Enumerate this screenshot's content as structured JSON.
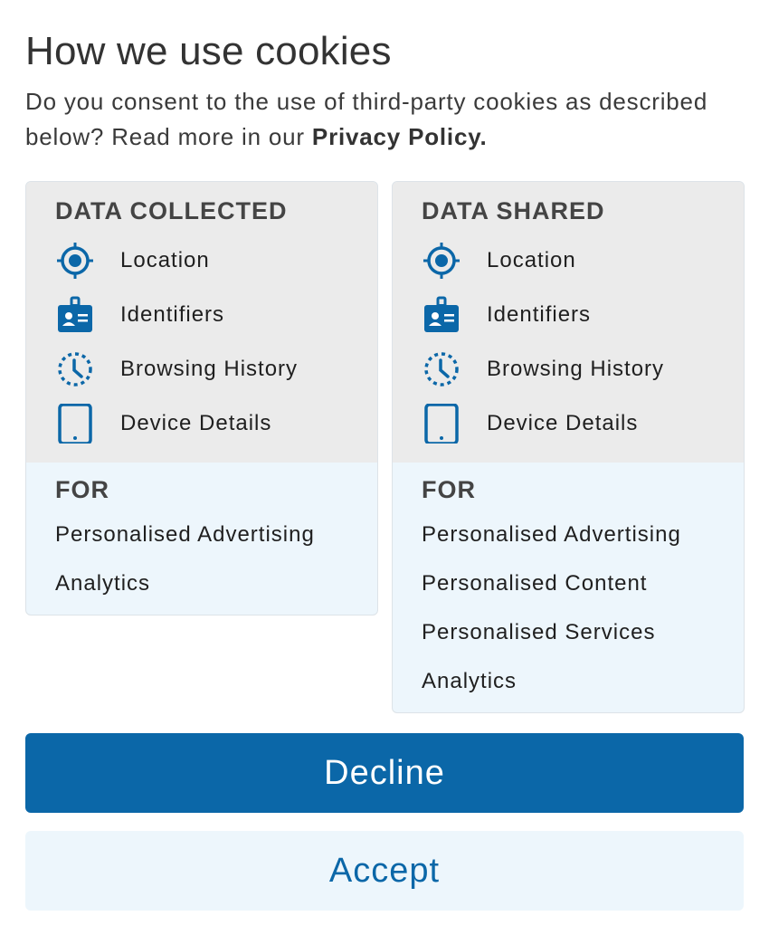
{
  "title": "How we use cookies",
  "intro": {
    "text": "Do you consent to the use of third-party cookies as described below? Read more in our ",
    "link": "Privacy Policy."
  },
  "colors": {
    "accent": "#0b67a8",
    "card_top": "#ebebeb",
    "card_bottom": "#edf6fc"
  },
  "collected": {
    "heading": "DATA COLLECTED",
    "items": [
      {
        "icon": "location-icon",
        "label": "Location"
      },
      {
        "icon": "id-badge-icon",
        "label": "Identifiers"
      },
      {
        "icon": "clock-history-icon",
        "label": "Browsing History"
      },
      {
        "icon": "tablet-icon",
        "label": "Device Details"
      }
    ],
    "for_heading": "FOR",
    "purposes": [
      "Personalised Advertising",
      "Analytics"
    ]
  },
  "shared": {
    "heading": "DATA SHARED",
    "items": [
      {
        "icon": "location-icon",
        "label": "Location"
      },
      {
        "icon": "id-badge-icon",
        "label": "Identifiers"
      },
      {
        "icon": "clock-history-icon",
        "label": "Browsing History"
      },
      {
        "icon": "tablet-icon",
        "label": "Device Details"
      }
    ],
    "for_heading": "FOR",
    "purposes": [
      "Personalised Advertising",
      "Personalised Content",
      "Personalised Services",
      "Analytics"
    ]
  },
  "buttons": {
    "decline": "Decline",
    "accept": "Accept"
  }
}
